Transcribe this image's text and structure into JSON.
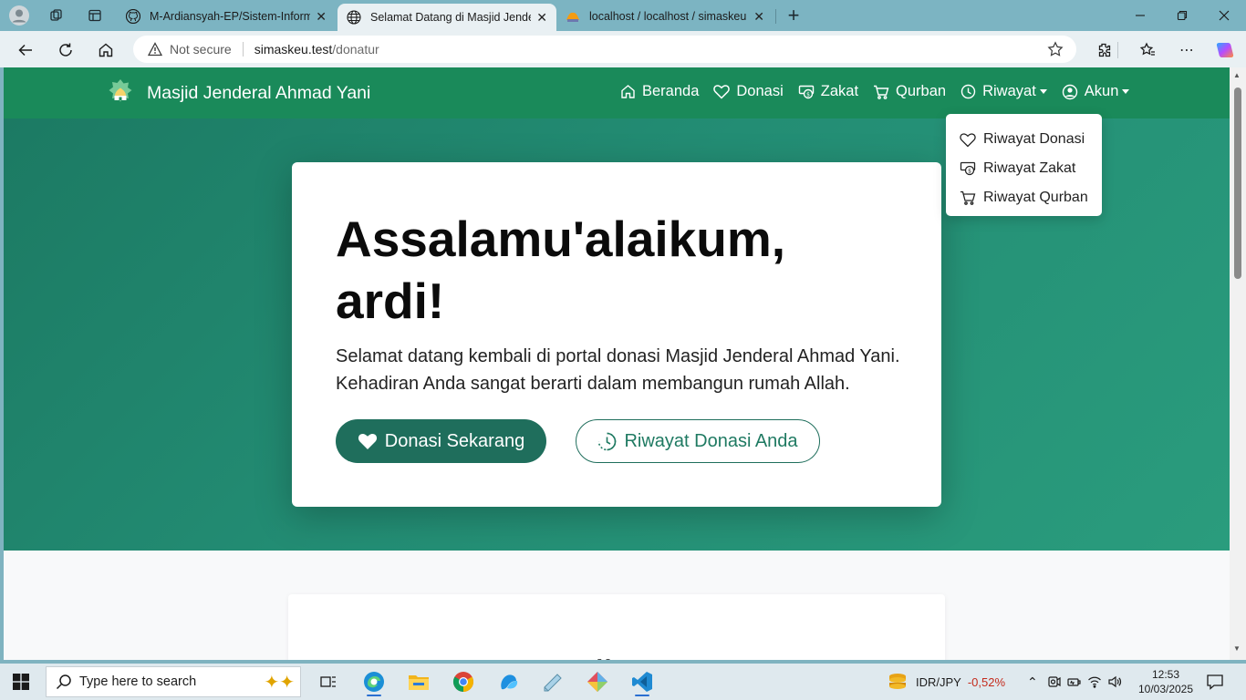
{
  "browser": {
    "tabs": [
      {
        "title": "M-Ardiansyah-EP/Sistem-Informasi-",
        "favicon": "github-icon",
        "active": false
      },
      {
        "title": "Selamat Datang di Masjid Jenderal",
        "favicon": "globe-icon",
        "active": true
      },
      {
        "title": "localhost / localhost / simaskeu / ",
        "favicon": "phpmyadmin-icon",
        "active": false
      }
    ],
    "new_tab": "+",
    "address": {
      "security": "Not secure",
      "host": "simaskeu.test",
      "path": "/donatur"
    }
  },
  "site": {
    "brand": "Masjid Jenderal Ahmad Yani",
    "nav": [
      {
        "label": "Beranda",
        "icon": "home-icon"
      },
      {
        "label": "Donasi",
        "icon": "heart-icon"
      },
      {
        "label": "Zakat",
        "icon": "coin-icon"
      },
      {
        "label": "Qurban",
        "icon": "cart-icon"
      },
      {
        "label": "Riwayat",
        "icon": "clock-icon",
        "dropdown": true
      },
      {
        "label": "Akun",
        "icon": "user-circle-icon",
        "dropdown": true
      }
    ],
    "dropdown": {
      "items": [
        {
          "label": "Riwayat Donasi",
          "icon": "heart-icon"
        },
        {
          "label": "Riwayat Zakat",
          "icon": "coin-icon"
        },
        {
          "label": "Riwayat Qurban",
          "icon": "cart-icon"
        }
      ]
    },
    "hero": {
      "heading": "Assalamu'alaikum, ardi!",
      "text": "Selamat datang kembali di portal donasi Masjid Jenderal Ahmad Yani. Kehadiran Anda sangat berarti dalam membangun rumah Allah.",
      "primary_button": "Donasi Sekarang",
      "secondary_button": "Riwayat Donasi Anda"
    },
    "section_peek": "“"
  },
  "taskbar": {
    "search_placeholder": "Type here to search",
    "ticker_symbol": "IDR/JPY",
    "ticker_change": "-0,52%",
    "time": "12:53",
    "date": "10/03/2025"
  },
  "colors": {
    "navbar": "#1a8a5a",
    "hero_start": "#1c7a63",
    "hero_end": "#2a9c7d",
    "primary_button": "#1f6e5c",
    "ticker_negative": "#c42b1c"
  }
}
